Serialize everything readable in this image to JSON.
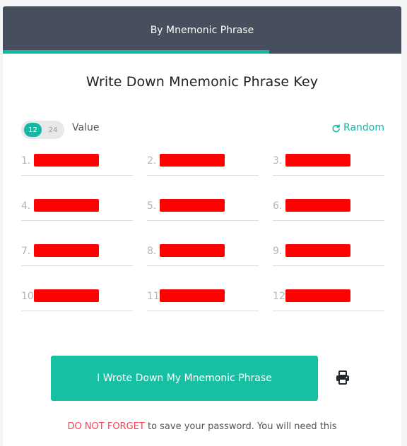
{
  "tabs": {
    "active_label": "By Mnemonic Phrase"
  },
  "title": "Write Down Mnemonic Phrase Key",
  "toggle": {
    "option_12": "12",
    "option_24": "24",
    "selected": "12"
  },
  "value_label": "Value",
  "random_label": "Random",
  "words": [
    {
      "number": "1."
    },
    {
      "number": "2."
    },
    {
      "number": "3."
    },
    {
      "number": "4."
    },
    {
      "number": "5."
    },
    {
      "number": "6."
    },
    {
      "number": "7."
    },
    {
      "number": "8."
    },
    {
      "number": "9."
    },
    {
      "number": "10"
    },
    {
      "number": "11."
    },
    {
      "number": "12."
    }
  ],
  "confirm_button": "I Wrote Down My Mnemonic Phrase",
  "print_icon": "printer-icon",
  "warning": {
    "highlight": "DO NOT FORGET",
    "rest": "to save your password. You will need this"
  },
  "colors": {
    "accent": "#14b8a6",
    "header_bg": "#474e5d",
    "danger": "#ff3b4f",
    "redaction": "#ff0000"
  }
}
